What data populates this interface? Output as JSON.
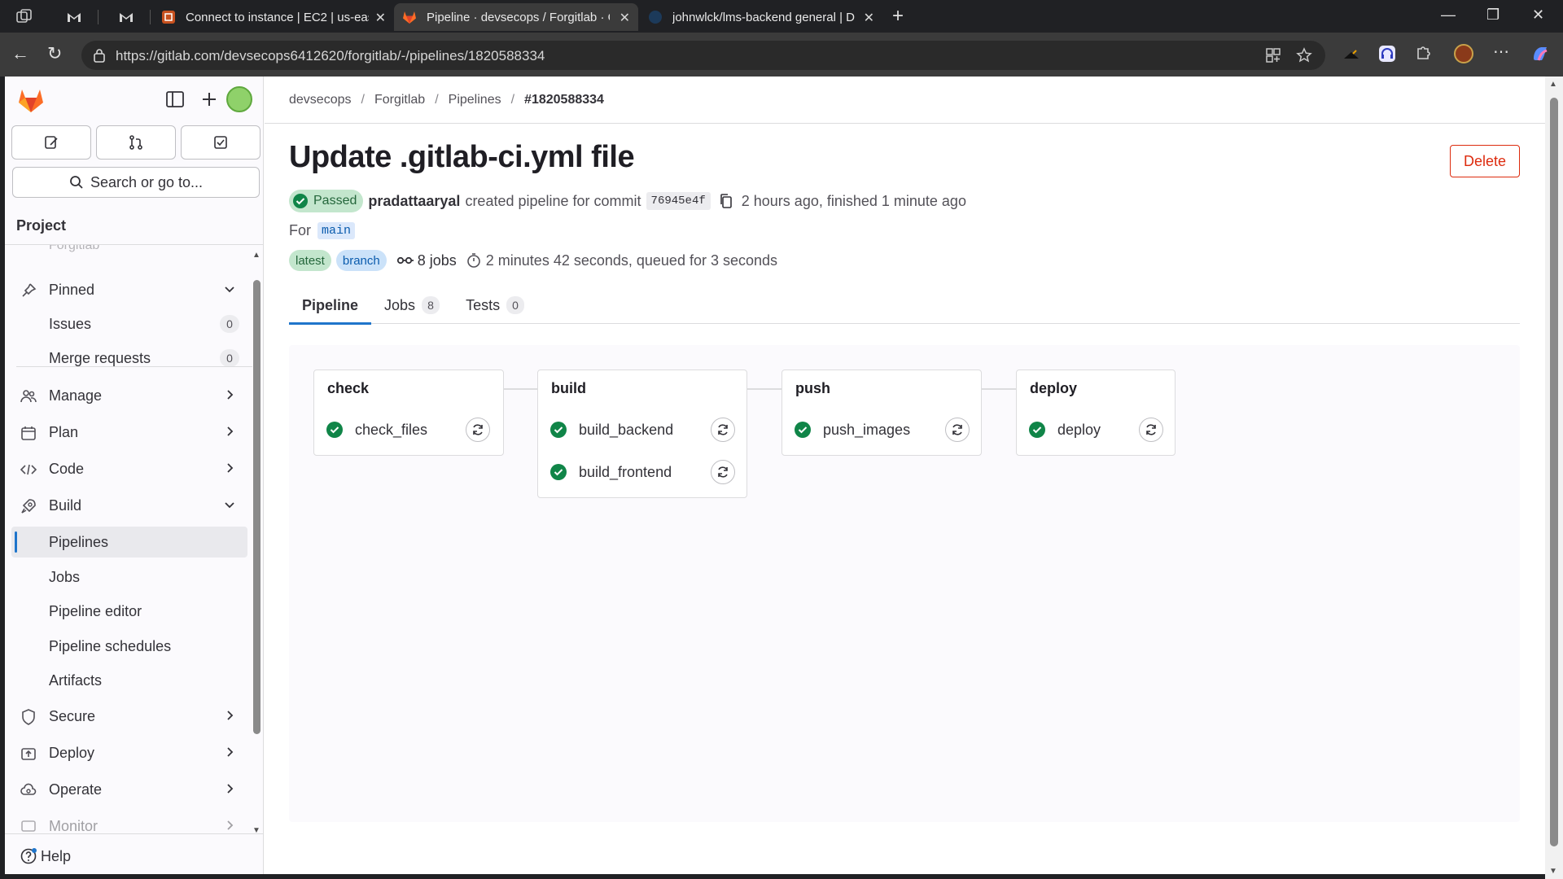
{
  "browser": {
    "tabs": [
      {
        "title": "Connect to instance | EC2 | us-eas"
      },
      {
        "title": "Pipeline · devsecops / Forgitlab · G"
      },
      {
        "title": "johnwlck/lms-backend general | D"
      }
    ],
    "url": "https://gitlab.com/devsecops6412620/forgitlab/-/pipelines/1820588334"
  },
  "sidebar": {
    "search_label": "Search or go to...",
    "section": "Project",
    "ghost": "Forgitlab",
    "items": [
      {
        "label": "Pinned"
      },
      {
        "label": "Issues",
        "count": "0"
      },
      {
        "label": "Merge requests",
        "count": "0"
      },
      {
        "label": "Manage"
      },
      {
        "label": "Plan"
      },
      {
        "label": "Code"
      },
      {
        "label": "Build"
      },
      {
        "label": "Pipelines"
      },
      {
        "label": "Jobs"
      },
      {
        "label": "Pipeline editor"
      },
      {
        "label": "Pipeline schedules"
      },
      {
        "label": "Artifacts"
      },
      {
        "label": "Secure"
      },
      {
        "label": "Deploy"
      },
      {
        "label": "Operate"
      },
      {
        "label": "Monitor"
      }
    ],
    "help": "Help"
  },
  "breadcrumb": [
    "devsecops",
    "Forgitlab",
    "Pipelines",
    "#1820588334"
  ],
  "pipeline": {
    "title": "Update .gitlab-ci.yml file",
    "delete_label": "Delete",
    "status": "Passed",
    "author": "pradattaaryal",
    "created_text": "created pipeline for commit",
    "sha": "76945e4f",
    "time_text": "2 hours ago, finished 1 minute ago",
    "for_label": "For",
    "ref": "main",
    "badge_latest": "latest",
    "badge_branch": "branch",
    "jobs_text": "8 jobs",
    "duration_text": "2 minutes 42 seconds, queued for 3 seconds"
  },
  "tabs": [
    {
      "label": "Pipeline"
    },
    {
      "label": "Jobs",
      "count": "8"
    },
    {
      "label": "Tests",
      "count": "0"
    }
  ],
  "stages": [
    {
      "name": "check",
      "jobs": [
        "check_files"
      ]
    },
    {
      "name": "build",
      "jobs": [
        "build_backend",
        "build_frontend"
      ]
    },
    {
      "name": "push",
      "jobs": [
        "push_images"
      ]
    },
    {
      "name": "deploy",
      "jobs": [
        "deploy"
      ]
    }
  ],
  "colors": {
    "success": "#108548",
    "danger": "#dd2b0e",
    "accent": "#1f75cb"
  }
}
